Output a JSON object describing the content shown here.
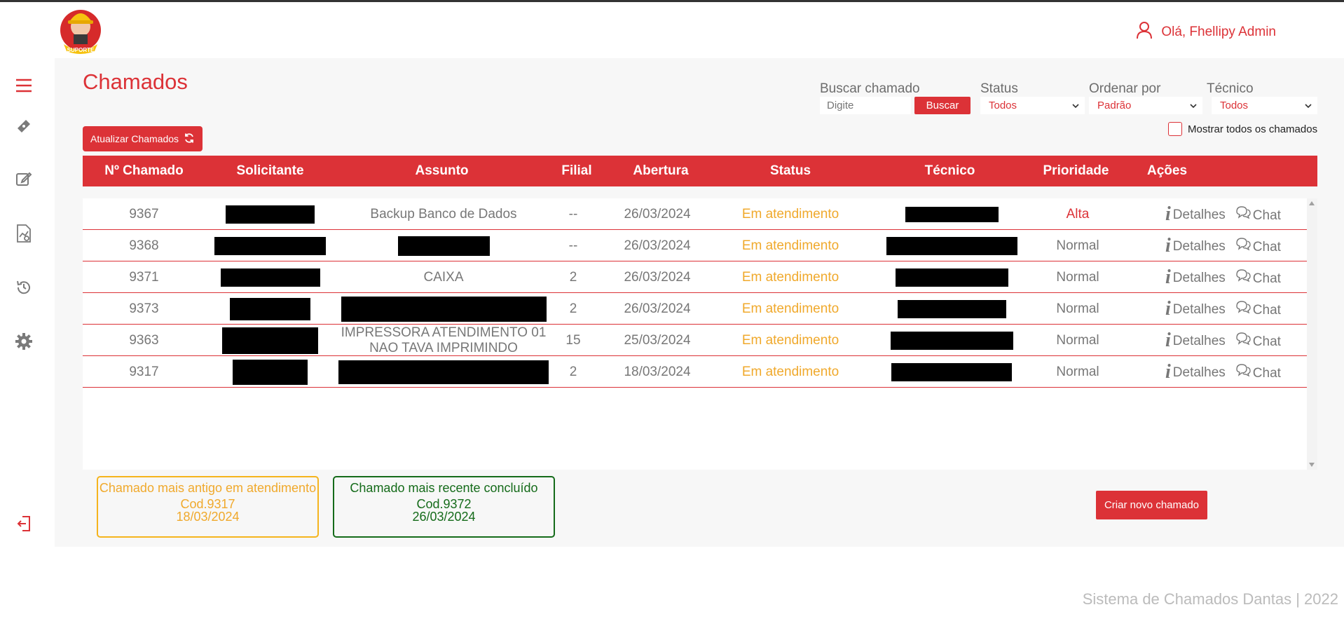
{
  "header": {
    "logo_icon": "mascot-logo-icon",
    "logo_text": "SUPORTE",
    "greeting": "Olá, Fhellipy Admin"
  },
  "sidebar": {
    "icons": [
      "menu-icon",
      "ticket-icon",
      "edit-icon",
      "report-icon",
      "history-icon",
      "gear-icon",
      "logout-icon"
    ]
  },
  "page": {
    "title": "Chamados",
    "refresh_label": "Atualizar Chamados"
  },
  "filters": {
    "search_label": "Buscar chamado",
    "search_placeholder": "Digite",
    "search_button": "Buscar",
    "status_label": "Status",
    "status_value": "Todos",
    "order_label": "Ordenar por",
    "order_value": "Padrão",
    "tech_label": "Técnico",
    "tech_value": "Todos",
    "show_all_label": "Mostrar todos os chamados"
  },
  "table": {
    "headers": [
      "Nº Chamado",
      "Solicitante",
      "Assunto",
      "Filial",
      "Abertura",
      "Status",
      "Técnico",
      "Prioridade",
      "Ações"
    ],
    "actions": {
      "details": "Detalhes",
      "chat": "Chat"
    },
    "rows": [
      {
        "id": "9367",
        "assunto": "Backup Banco de Dados",
        "filial": "--",
        "abertura": "26/03/2024",
        "status": "Em atendimento",
        "prioridade": "Alta"
      },
      {
        "id": "9368",
        "assunto": "",
        "filial": "--",
        "abertura": "26/03/2024",
        "status": "Em atendimento",
        "prioridade": "Normal"
      },
      {
        "id": "9371",
        "assunto": "CAIXA",
        "filial": "2",
        "abertura": "26/03/2024",
        "status": "Em atendimento",
        "prioridade": "Normal"
      },
      {
        "id": "9373",
        "assunto": "",
        "filial": "2",
        "abertura": "26/03/2024",
        "status": "Em atendimento",
        "prioridade": "Normal"
      },
      {
        "id": "9363",
        "assunto": "IMPRESSORA ATENDIMENTO 01 NAO TAVA IMPRIMINDO",
        "filial": "15",
        "abertura": "25/03/2024",
        "status": "Em atendimento",
        "prioridade": "Normal"
      },
      {
        "id": "9317",
        "assunto": "",
        "filial": "2",
        "abertura": "18/03/2024",
        "status": "Em atendimento",
        "prioridade": "Normal"
      }
    ]
  },
  "summary": {
    "oldest_title": "Chamado mais antigo em atendimento",
    "oldest_code": "Cod.9317",
    "oldest_date": "18/03/2024",
    "recent_title": "Chamado mais recente concluído",
    "recent_code": "Cod.9372",
    "recent_date": "26/03/2024"
  },
  "create_button": "Criar novo chamado",
  "footer": "Sistema de Chamados Dantas | 2022",
  "colors": {
    "accent": "#dc3237",
    "in_progress": "#f0a92c",
    "done": "#156b1a"
  }
}
